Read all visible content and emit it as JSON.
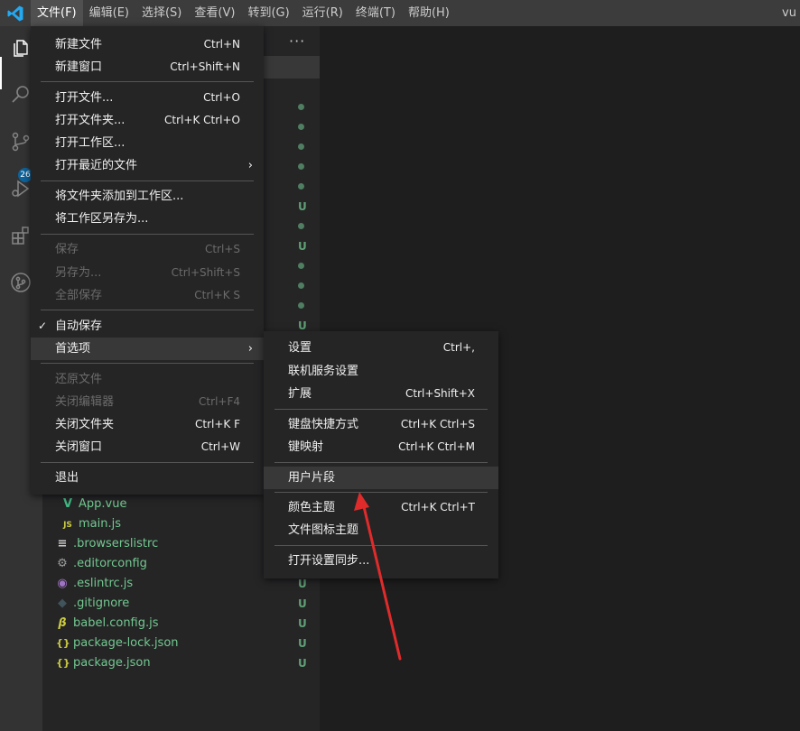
{
  "window": {
    "title": "vu"
  },
  "menubar": [
    {
      "label": "文件(F)",
      "active": true
    },
    {
      "label": "编辑(E)"
    },
    {
      "label": "选择(S)"
    },
    {
      "label": "查看(V)"
    },
    {
      "label": "转到(G)"
    },
    {
      "label": "运行(R)"
    },
    {
      "label": "终端(T)"
    },
    {
      "label": "帮助(H)"
    }
  ],
  "activitybar": {
    "icons": [
      "explorer-icon",
      "search-icon",
      "source-control-icon",
      "run-debug-icon",
      "extensions-icon",
      "git-graph-icon"
    ],
    "scm_badge": "26"
  },
  "sidebar": {
    "more": "···",
    "status_u": "U",
    "files": [
      {
        "icon": "V",
        "name": "App.vue",
        "status": ""
      },
      {
        "icon": "JS",
        "name": "main.js",
        "status": ""
      },
      {
        "icon": "≡",
        "name": ".browserslistrc",
        "status": ""
      },
      {
        "icon": "⚙",
        "name": ".editorconfig",
        "status": ""
      },
      {
        "icon": "◉",
        "name": ".eslintrc.js",
        "status": "U"
      },
      {
        "icon": "◆",
        "name": ".gitignore",
        "status": "U"
      },
      {
        "icon": "β",
        "name": "babel.config.js",
        "status": "U"
      },
      {
        "icon": "{}",
        "name": "package-lock.json",
        "status": "U"
      },
      {
        "icon": "{}",
        "name": "package.json",
        "status": "U"
      }
    ]
  },
  "file_menu": [
    {
      "label": "新建文件",
      "kb": "Ctrl+N"
    },
    {
      "label": "新建窗口",
      "kb": "Ctrl+Shift+N"
    },
    {
      "label": "打开文件...",
      "kb": "Ctrl+O"
    },
    {
      "label": "打开文件夹...",
      "kb": "Ctrl+K Ctrl+O"
    },
    {
      "label": "打开工作区...",
      "kb": ""
    },
    {
      "label": "打开最近的文件",
      "kb": "",
      "submenu": "›"
    },
    {
      "label": "将文件夹添加到工作区...",
      "kb": ""
    },
    {
      "label": "将工作区另存为...",
      "kb": ""
    },
    {
      "label": "保存",
      "kb": "Ctrl+S",
      "disabled": true
    },
    {
      "label": "另存为...",
      "kb": "Ctrl+Shift+S",
      "disabled": true
    },
    {
      "label": "全部保存",
      "kb": "Ctrl+K S",
      "disabled": true
    },
    {
      "label": "自动保存",
      "kb": "",
      "checked": "✓"
    },
    {
      "label": "首选项",
      "kb": "",
      "submenu": "›"
    },
    {
      "label": "还原文件",
      "kb": "",
      "disabled": true
    },
    {
      "label": "关闭编辑器",
      "kb": "Ctrl+F4",
      "disabled": true
    },
    {
      "label": "关闭文件夹",
      "kb": "Ctrl+K F"
    },
    {
      "label": "关闭窗口",
      "kb": "Ctrl+W"
    },
    {
      "label": "退出",
      "kb": ""
    }
  ],
  "preferences_menu": [
    {
      "label": "设置",
      "kb": "Ctrl+,"
    },
    {
      "label": "联机服务设置",
      "kb": ""
    },
    {
      "label": "扩展",
      "kb": "Ctrl+Shift+X"
    },
    {
      "label": "键盘快捷方式",
      "kb": "Ctrl+K Ctrl+S"
    },
    {
      "label": "键映射",
      "kb": "Ctrl+K Ctrl+M"
    },
    {
      "label": "用户片段",
      "kb": ""
    },
    {
      "label": "颜色主题",
      "kb": "Ctrl+K Ctrl+T"
    },
    {
      "label": "文件图标主题",
      "kb": ""
    },
    {
      "label": "打开设置同步...",
      "kb": ""
    }
  ],
  "colors": {
    "accent": "#007acc",
    "git_untracked": "#73c991",
    "annotation_arrow": "#e02b2b"
  }
}
